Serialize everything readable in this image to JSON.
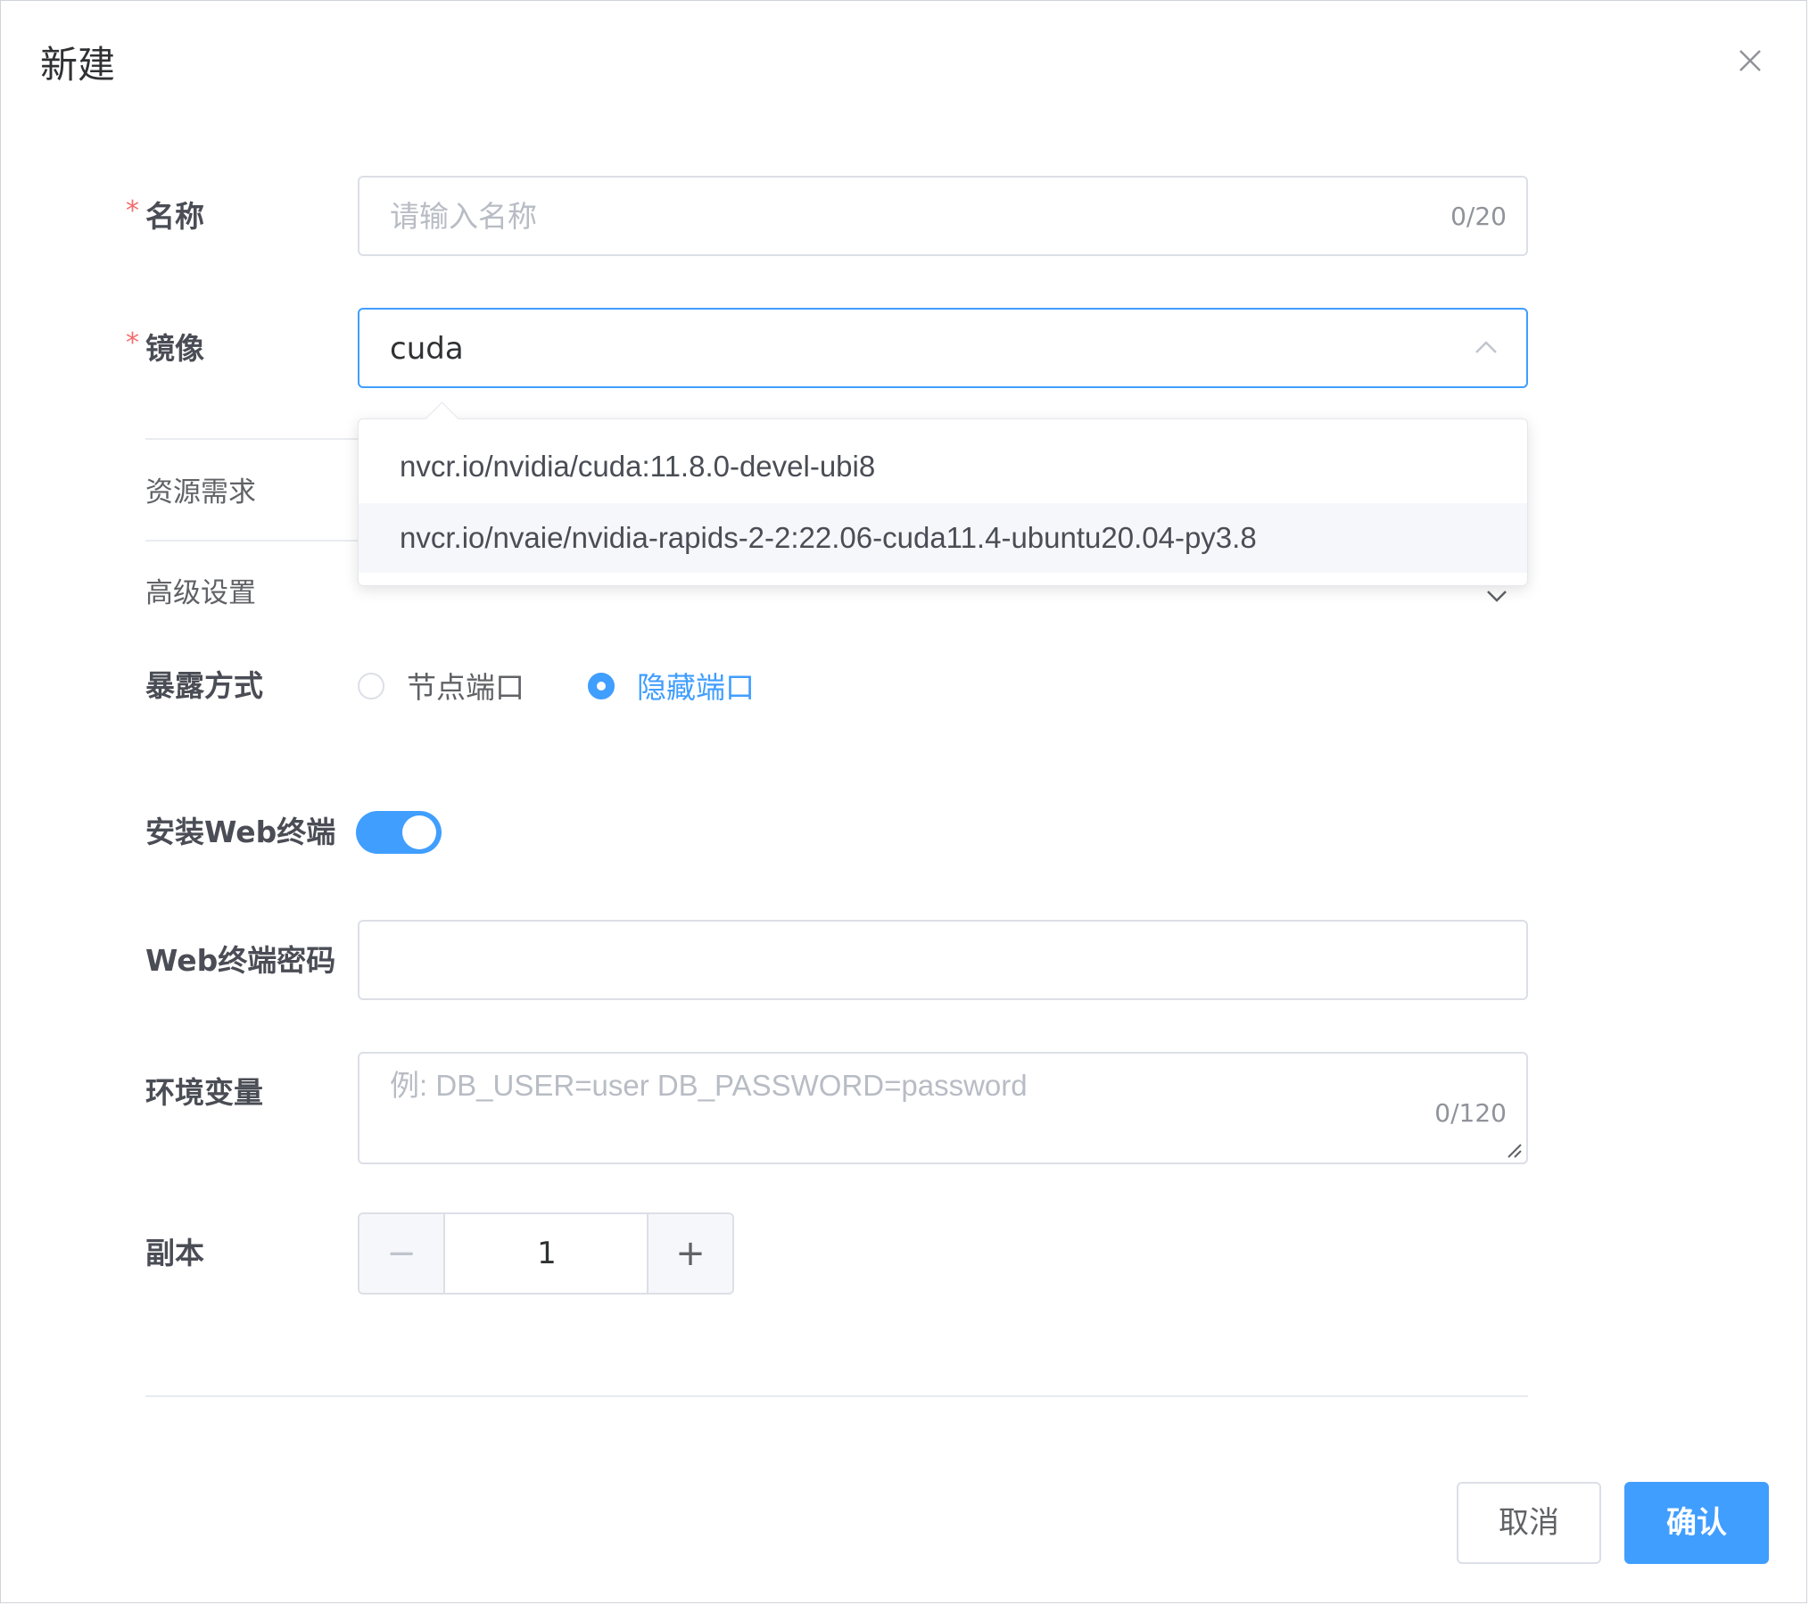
{
  "dialog": {
    "title": "新建",
    "close_icon": "close-icon"
  },
  "form": {
    "name": {
      "label": "名称",
      "required_mark": "*",
      "placeholder": "请输入名称",
      "counter": "0/20"
    },
    "image": {
      "label": "镜像",
      "required_mark": "*",
      "value": "cuda",
      "options": [
        "nvcr.io/nvidia/cuda:11.8.0-devel-ubi8",
        "nvcr.io/nvaie/nvidia-rapids-2-2:22.06-cuda11.4-ubuntu20.04-py3.8"
      ]
    },
    "resources": {
      "label": "资源需求"
    },
    "advanced": {
      "label": "高级设置"
    },
    "exposure": {
      "label": "暴露方式",
      "options": [
        "节点端口",
        "隐藏端口"
      ],
      "selected": "隐藏端口"
    },
    "web_terminal": {
      "label": "安装Web终端",
      "enabled": true
    },
    "web_password": {
      "label": "Web终端密码",
      "value": ""
    },
    "env": {
      "label": "环境变量",
      "placeholder": "例: DB_USER=user DB_PASSWORD=password",
      "counter": "0/120"
    },
    "replicas": {
      "label": "副本",
      "value": "1",
      "minus": "−",
      "plus": "+"
    }
  },
  "footer": {
    "cancel_label": "取消",
    "confirm_label": "确认"
  },
  "colors": {
    "primary": "#409eff",
    "required": "#f56c6c"
  }
}
